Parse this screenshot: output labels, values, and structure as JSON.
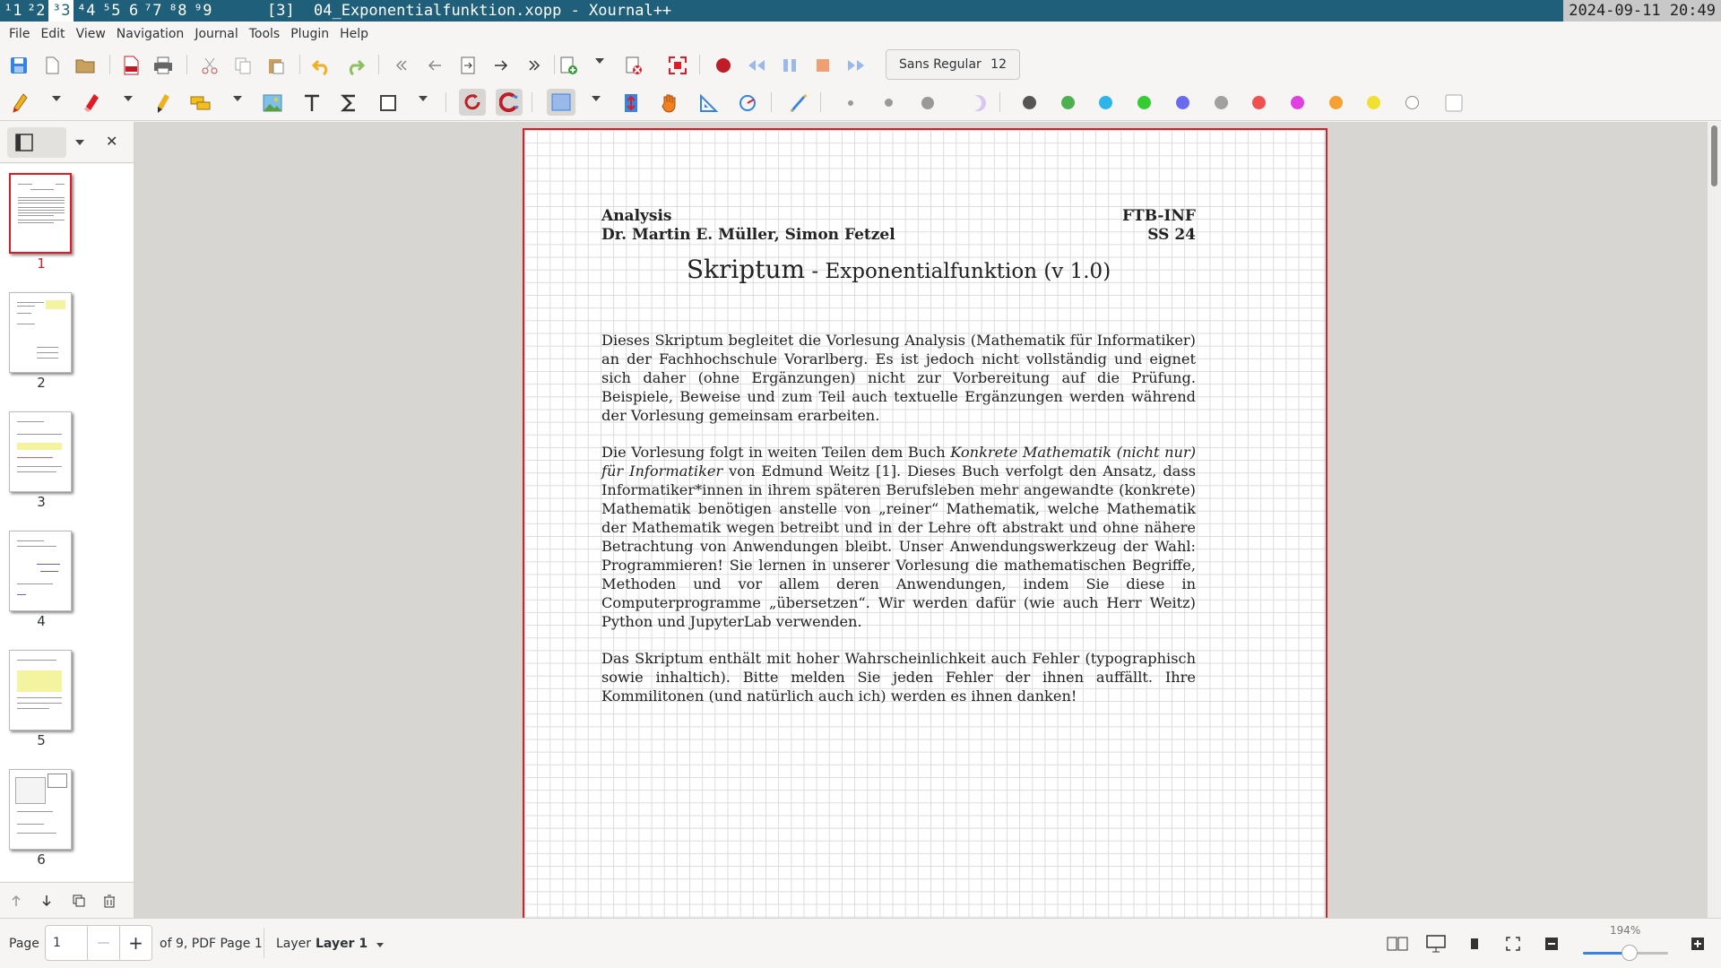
{
  "topbar": {
    "workspaces": [
      {
        "num": "1",
        "sup": "¹"
      },
      {
        "num": "2",
        "sup": "²"
      },
      {
        "num": "3",
        "sup": "³"
      },
      {
        "num": "4",
        "sup": "⁴"
      },
      {
        "num": "5",
        "sup": "⁵"
      },
      {
        "num": "6",
        "sup": ""
      },
      {
        "num": "7",
        "sup": "⁷"
      },
      {
        "num": "8",
        "sup": "⁸"
      },
      {
        "num": "9",
        "sup": "⁹"
      }
    ],
    "ws_labels": [
      "¹1",
      "²2",
      "³3",
      "⁴4",
      "⁵5",
      "6",
      "⁷7",
      "⁸8",
      "⁹9"
    ],
    "layout": "[3]",
    "window_title": "04_Exponentialfunktion.xopp - Xournal++",
    "clock": "2024-09-11 20:49"
  },
  "menu": [
    "File",
    "Edit",
    "View",
    "Navigation",
    "Journal",
    "Tools",
    "Plugin",
    "Help"
  ],
  "toolbar": {
    "font_name": "Sans Regular",
    "font_size": "12",
    "colors": [
      "#555555",
      "#4caf50",
      "#2cb5e8",
      "#33cc33",
      "#6a6af0",
      "#a0a0a0",
      "#f05050",
      "#e040e0",
      "#f5a030",
      "#f0e030",
      "#ffffff"
    ]
  },
  "sidebar": {
    "pages": [
      "1",
      "2",
      "3",
      "4",
      "5",
      "6"
    ],
    "selected": "1"
  },
  "document": {
    "header_left_1": "Analysis",
    "header_left_2": "Dr. Martin E. Müller, Simon Fetzel",
    "header_right_1": "FTB-INF",
    "header_right_2": "SS 24",
    "title_main": "Skriptum",
    "title_sub": " - Exponentialfunktion (v 1.0)",
    "para1": "Dieses Skriptum begleitet die Vorlesung Analysis (Mathematik für Informatiker) an der Fachhochschule Vorarlberg. Es ist jedoch nicht vollständig und eignet sich daher (ohne Ergänzungen) nicht zur Vorbereitung auf die Prüfung. Beispiele, Beweise und zum Teil auch textuelle Ergänzungen werden während der Vorlesung gemeinsam erarbeiten.",
    "para2_a": "Die Vorlesung folgt in weiten Teilen dem Buch ",
    "para2_em": "Konkrete Mathematik (nicht nur) für Informatiker",
    "para2_b": " von Edmund Weitz [1]. Dieses Buch verfolgt den Ansatz, dass Informatiker*innen in ihrem späteren Berufsleben mehr angewandte (konkrete) Mathematik benötigen anstelle von „reiner“ Mathematik, welche Mathematik der Mathematik wegen betreibt und in der Lehre oft abstrakt und ohne nähere Betrachtung von Anwendungen bleibt. Unser Anwendungswerkzeug der Wahl: Programmieren! Sie lernen in unserer Vorlesung die mathematischen Begriffe, Methoden und vor allem deren Anwendungen, indem Sie diese in Computerprogramme „übersetzen“. Wir werden dafür (wie auch Herr Weitz) Python und JupyterLab verwenden.",
    "para3": "Das Skriptum enthält mit hoher Wahrscheinlichkeit auch Fehler (typographisch sowie inhaltich). Bitte melden Sie jeden Fehler der ihnen auffällt. Ihre Kommilitonen (und natürlich auch ich) werden es ihnen danken!"
  },
  "statusbar": {
    "page_label": "Page",
    "page_value": "1",
    "minus": "—",
    "plus": "+",
    "of_text": "of 9, PDF Page 1",
    "layer_label": "Layer",
    "layer_value": "Layer 1",
    "zoom": "194%",
    "zoom_fraction": 0.55
  }
}
